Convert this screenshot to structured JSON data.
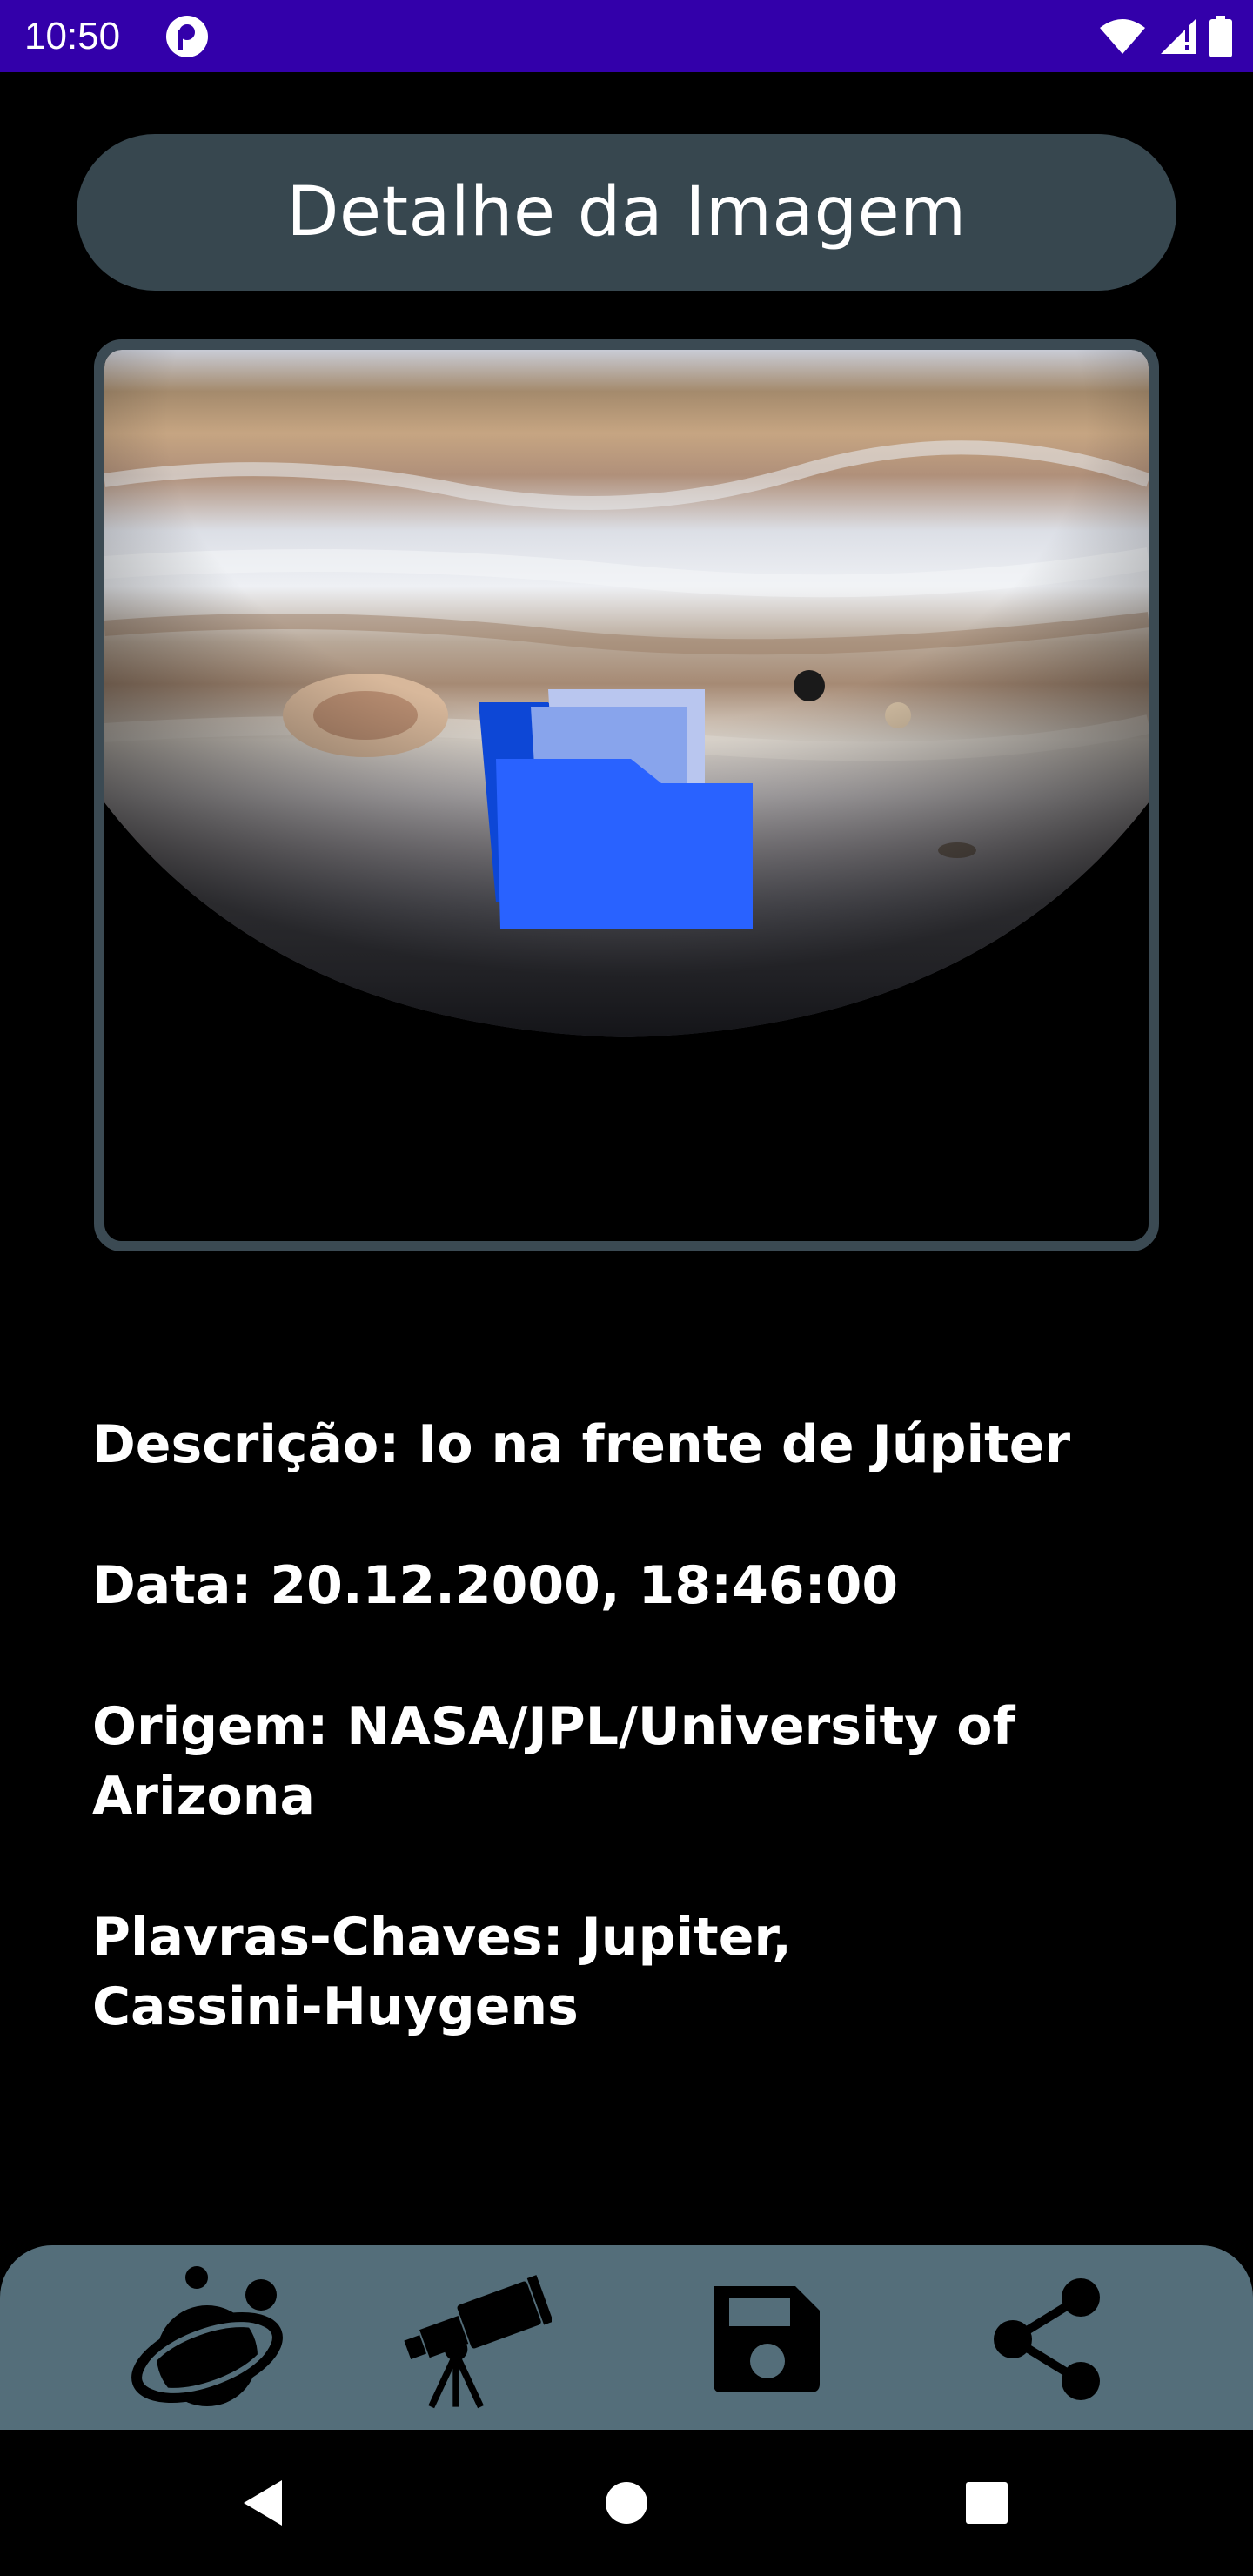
{
  "status_bar": {
    "time": "10:50",
    "icons": [
      "app-badge-icon",
      "wifi-icon",
      "signal-icon",
      "battery-icon"
    ]
  },
  "header": {
    "title": "Detalhe da Imagem"
  },
  "image": {
    "subject": "Jupiter with Io",
    "overlay_icon": "folder-icon"
  },
  "details": {
    "description": "Descrição: Io na frente de Júpiter",
    "date": "Data: 20.12.2000,  18:46:00",
    "origin_line1": "Origem: NASA/JPL/University of",
    "origin_line2": "Arizona",
    "keywords_line1": "Plavras-Chaves: Jupiter,",
    "keywords_line2": "Cassini-Huygens"
  },
  "bottom_nav": {
    "items": [
      {
        "icon": "planet-icon"
      },
      {
        "icon": "telescope-icon"
      },
      {
        "icon": "save-icon"
      },
      {
        "icon": "share-icon"
      }
    ]
  },
  "system_nav": {
    "buttons": [
      "back-icon",
      "home-icon",
      "recents-icon"
    ]
  },
  "colors": {
    "status_bar": "#3300aa",
    "title_pill": "#37474f",
    "frame_border": "#3b4a53",
    "bottom_bar": "#546e7a",
    "folder_blue": "#2962ff"
  }
}
